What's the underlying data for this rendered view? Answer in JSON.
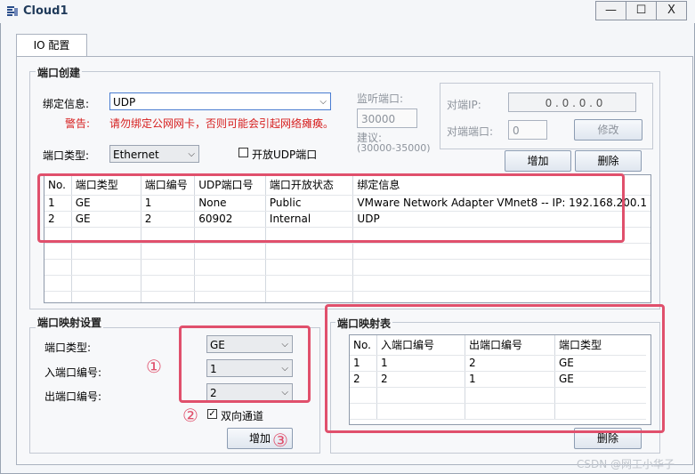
{
  "window": {
    "title": "Cloud1",
    "minimize": "—",
    "maximize": "☐",
    "close": "X"
  },
  "tab": {
    "label": "IO 配置"
  },
  "port_creation": {
    "title": "端口创建",
    "binding_label": "绑定信息:",
    "binding_value": "UDP",
    "warning_label": "警告:",
    "warning_text": "请勿绑定公网网卡，否则可能会引起网络瘫痪。",
    "port_type_label": "端口类型:",
    "port_type_value": "Ethernet",
    "open_udp_label": "开放UDP端口",
    "listen_label": "监听端口:",
    "listen_value": "30000",
    "suggest_label": "建议:",
    "suggest_range": "(30000-35000)",
    "peer_ip_label": "对端IP:",
    "peer_ip_value": "0 . 0 . 0 . 0",
    "peer_port_label": "对端端口:",
    "peer_port_value": "0",
    "modify_button": "修改",
    "add_button": "增加",
    "delete_button": "删除"
  },
  "ports_table": {
    "headers": [
      "No.",
      "端口类型",
      "端口编号",
      "UDP端口号",
      "端口开放状态",
      "绑定信息"
    ],
    "rows": [
      [
        "1",
        "GE",
        "1",
        "None",
        "Public",
        "VMware Network Adapter VMnet8 -- IP: 192.168.200.1"
      ],
      [
        "2",
        "GE",
        "2",
        "60902",
        "Internal",
        "UDP"
      ]
    ]
  },
  "mapping_settings": {
    "title": "端口映射设置",
    "port_type_label": "端口类型:",
    "port_type_value": "GE",
    "in_port_label": "入端口编号:",
    "in_port_value": "1",
    "out_port_label": "出端口编号:",
    "out_port_value": "2",
    "bidirectional_label": "双向通道",
    "add_button": "增加"
  },
  "mapping_table": {
    "title": "端口映射表",
    "headers": [
      "No.",
      "入端口编号",
      "出端口编号",
      "端口类型"
    ],
    "rows": [
      [
        "1",
        "1",
        "2",
        "GE"
      ],
      [
        "2",
        "2",
        "1",
        "GE"
      ]
    ],
    "delete_button": "删除"
  },
  "annotations": {
    "one": "①",
    "two": "②",
    "three": "③"
  },
  "watermark": "CSDN @网工小华子",
  "colors": {
    "annotation": "#e0506c",
    "warning": "#d61e1e"
  }
}
